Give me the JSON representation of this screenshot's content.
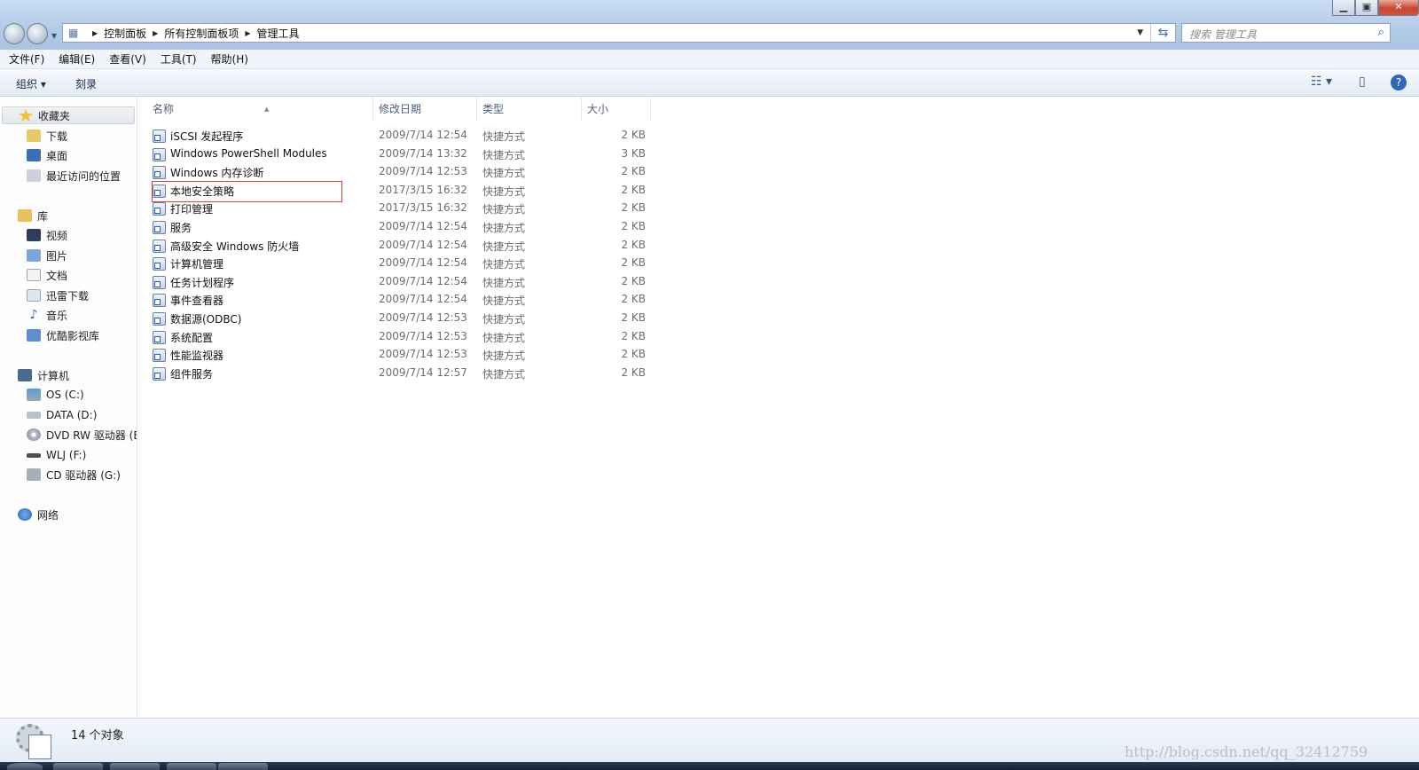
{
  "address": {
    "breadcrumbs": [
      "控制面板",
      "所有控制面板项",
      "管理工具"
    ],
    "search_placeholder": "搜索 管理工具"
  },
  "menu": [
    "文件(F)",
    "编辑(E)",
    "查看(V)",
    "工具(T)",
    "帮助(H)"
  ],
  "toolbar": {
    "organize": "组织 ▾",
    "burn": "刻录"
  },
  "nav": {
    "favorites": {
      "label": "收藏夹",
      "items": [
        "下载",
        "桌面",
        "最近访问的位置"
      ]
    },
    "libraries": {
      "label": "库",
      "items": [
        "视频",
        "图片",
        "文档",
        "迅雷下载",
        "音乐",
        "优酷影视库"
      ]
    },
    "computer": {
      "label": "计算机",
      "items": [
        "OS (C:)",
        "DATA (D:)",
        "DVD RW 驱动器 (E",
        "WLJ (F:)",
        "CD 驱动器 (G:)"
      ]
    },
    "network": {
      "label": "网络"
    }
  },
  "columns": {
    "name": "名称",
    "date": "修改日期",
    "type": "类型",
    "size": "大小"
  },
  "files": [
    {
      "name": "iSCSI 发起程序",
      "date": "2009/7/14 12:54",
      "type": "快捷方式",
      "size": "2 KB"
    },
    {
      "name": "Windows PowerShell Modules",
      "date": "2009/7/14 13:32",
      "type": "快捷方式",
      "size": "3 KB"
    },
    {
      "name": "Windows 内存诊断",
      "date": "2009/7/14 12:53",
      "type": "快捷方式",
      "size": "2 KB"
    },
    {
      "name": "本地安全策略",
      "date": "2017/3/15 16:32",
      "type": "快捷方式",
      "size": "2 KB"
    },
    {
      "name": "打印管理",
      "date": "2017/3/15 16:32",
      "type": "快捷方式",
      "size": "2 KB"
    },
    {
      "name": "服务",
      "date": "2009/7/14 12:54",
      "type": "快捷方式",
      "size": "2 KB"
    },
    {
      "name": "高级安全 Windows 防火墙",
      "date": "2009/7/14 12:54",
      "type": "快捷方式",
      "size": "2 KB"
    },
    {
      "name": "计算机管理",
      "date": "2009/7/14 12:54",
      "type": "快捷方式",
      "size": "2 KB"
    },
    {
      "name": "任务计划程序",
      "date": "2009/7/14 12:54",
      "type": "快捷方式",
      "size": "2 KB"
    },
    {
      "name": "事件查看器",
      "date": "2009/7/14 12:54",
      "type": "快捷方式",
      "size": "2 KB"
    },
    {
      "name": "数据源(ODBC)",
      "date": "2009/7/14 12:53",
      "type": "快捷方式",
      "size": "2 KB"
    },
    {
      "name": "系统配置",
      "date": "2009/7/14 12:53",
      "type": "快捷方式",
      "size": "2 KB"
    },
    {
      "name": "性能监视器",
      "date": "2009/7/14 12:53",
      "type": "快捷方式",
      "size": "2 KB"
    },
    {
      "name": "组件服务",
      "date": "2009/7/14 12:57",
      "type": "快捷方式",
      "size": "2 KB"
    }
  ],
  "status": {
    "count": "14 个对象"
  },
  "watermark": "http://blog.csdn.net/qq_32412759",
  "colors": {
    "highlight": "#e23b3b",
    "accent": "#3c5a80"
  }
}
